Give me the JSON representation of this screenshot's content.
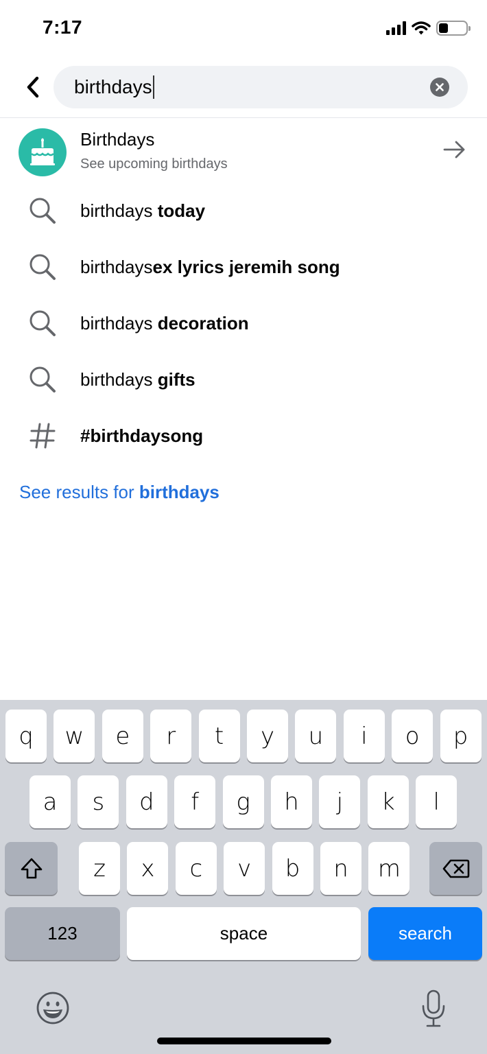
{
  "status_bar": {
    "time": "7:17",
    "icons": [
      "cellular-signal-icon",
      "wifi-icon",
      "battery-icon"
    ],
    "battery_level": 0.35
  },
  "search": {
    "value": "birthdays",
    "back_icon": "chevron-left-icon",
    "clear_icon": "clear-circle-icon"
  },
  "birthday_shortcut": {
    "title": "Birthdays",
    "subtitle": "See upcoming birthdays",
    "icon": "birthday-cake-icon",
    "icon_color": "#2abba7",
    "trailing_icon": "arrow-right-icon"
  },
  "suggestions": [
    {
      "icon": "search-icon",
      "prefix": "birthdays ",
      "bold": "today"
    },
    {
      "icon": "search-icon",
      "prefix": "birthdays",
      "bold": "ex lyrics jeremih song"
    },
    {
      "icon": "search-icon",
      "prefix": "birthdays ",
      "bold": "decoration"
    },
    {
      "icon": "search-icon",
      "prefix": "birthdays ",
      "bold": "gifts"
    },
    {
      "icon": "hashtag-icon",
      "prefix": "",
      "bold": "#birthdaysong"
    }
  ],
  "see_results": {
    "prefix": "See results for ",
    "query": "birthdays",
    "color": "#216fdb"
  },
  "keyboard": {
    "row1": [
      "q",
      "w",
      "e",
      "r",
      "t",
      "y",
      "u",
      "i",
      "o",
      "p"
    ],
    "row2": [
      "a",
      "s",
      "d",
      "f",
      "g",
      "h",
      "j",
      "k",
      "l"
    ],
    "row3": [
      "z",
      "x",
      "c",
      "v",
      "b",
      "n",
      "m"
    ],
    "shift_icon": "shift-arrow-icon",
    "delete_icon": "backspace-icon",
    "numbers_label": "123",
    "space_label": "space",
    "action_label": "search",
    "action_color": "#0a7cf9",
    "emoji_icon": "emoji-icon",
    "mic_icon": "microphone-icon"
  }
}
